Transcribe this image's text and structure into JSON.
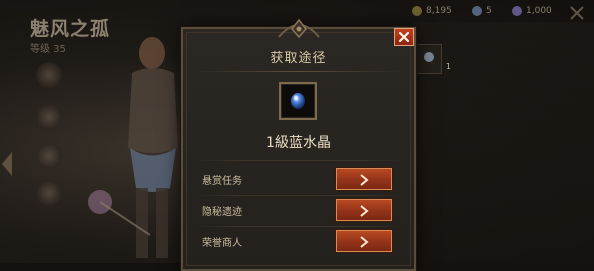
{
  "background": {
    "hero_title": "魅风之孤",
    "hero_level": "等级 35",
    "resources": [
      "8,195",
      "5",
      "1,000"
    ],
    "side_item_count": "1"
  },
  "popup": {
    "title": "获取途径",
    "item": {
      "name": "1級蓝水晶",
      "icon": "blue-crystal-icon"
    },
    "close_icon": "close-icon",
    "sources": [
      {
        "label": "悬赏任务",
        "button_icon": "chevron-right-icon"
      },
      {
        "label": "隐秘遗迹",
        "button_icon": "chevron-right-icon"
      },
      {
        "label": "荣誉商人",
        "button_icon": "chevron-right-icon"
      }
    ]
  },
  "colors": {
    "accent_button": "#b84a22",
    "title_text": "#d6c9a6",
    "crystal": "#4a7fd8"
  }
}
